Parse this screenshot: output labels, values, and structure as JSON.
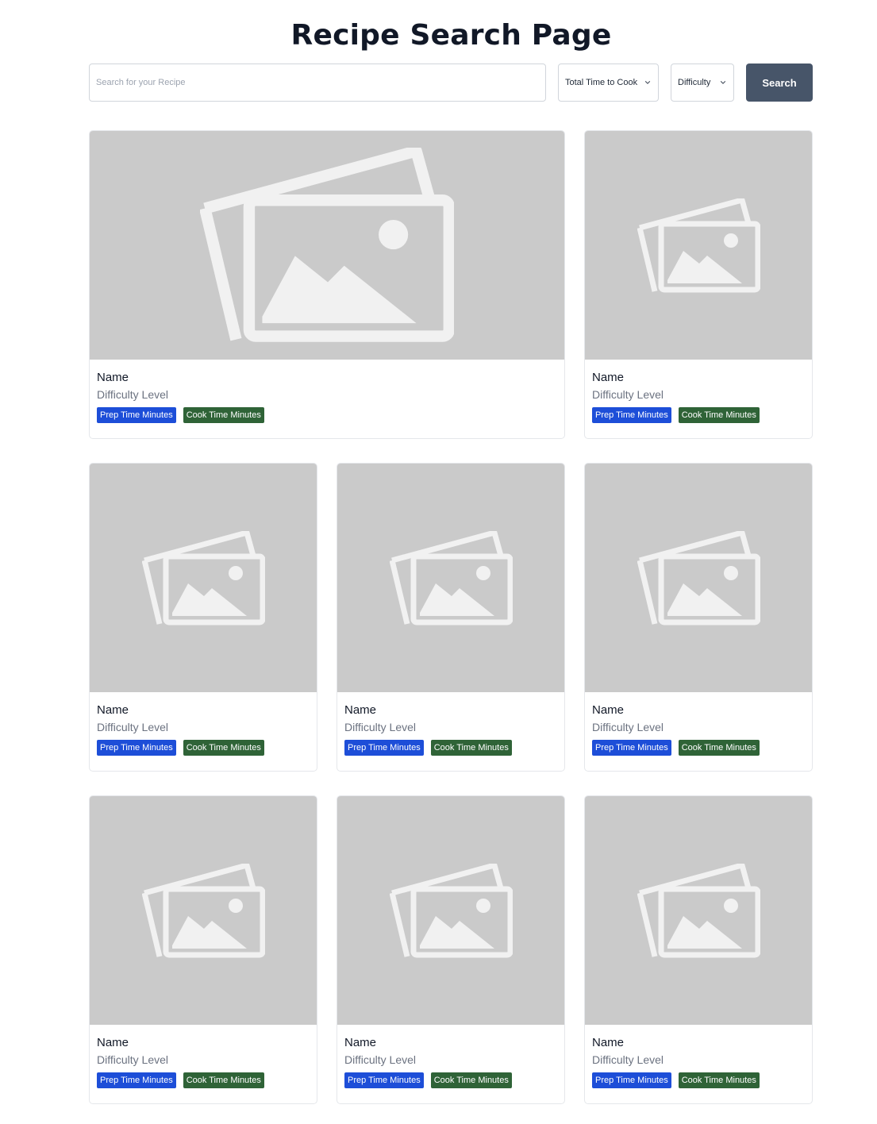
{
  "header": {
    "title": "Recipe Search Page"
  },
  "search": {
    "placeholder": "Search for your Recipe",
    "value": "",
    "time_select": "Total Time to Cook",
    "difficulty_select": "Difficulty",
    "button_label": "Search",
    "button_color": "#475569"
  },
  "cards": [
    {
      "name": "Name",
      "difficulty": "Difficulty Level",
      "prep": "Prep Time Minutes",
      "cook": "Cook Time Minutes",
      "image_icon": "image-placeholder-icon"
    },
    {
      "name": "Name",
      "difficulty": "Difficulty Level",
      "prep": "Prep Time Minutes",
      "cook": "Cook Time Minutes",
      "image_icon": "image-placeholder-icon"
    },
    {
      "name": "Name",
      "difficulty": "Difficulty Level",
      "prep": "Prep Time Minutes",
      "cook": "Cook Time Minutes",
      "image_icon": "image-placeholder-icon"
    },
    {
      "name": "Name",
      "difficulty": "Difficulty Level",
      "prep": "Prep Time Minutes",
      "cook": "Cook Time Minutes",
      "image_icon": "image-placeholder-icon"
    },
    {
      "name": "Name",
      "difficulty": "Difficulty Level",
      "prep": "Prep Time Minutes",
      "cook": "Cook Time Minutes",
      "image_icon": "image-placeholder-icon"
    },
    {
      "name": "Name",
      "difficulty": "Difficulty Level",
      "prep": "Prep Time Minutes",
      "cook": "Cook Time Minutes",
      "image_icon": "image-placeholder-icon"
    },
    {
      "name": "Name",
      "difficulty": "Difficulty Level",
      "prep": "Prep Time Minutes",
      "cook": "Cook Time Minutes",
      "image_icon": "image-placeholder-icon"
    },
    {
      "name": "Name",
      "difficulty": "Difficulty Level",
      "prep": "Prep Time Minutes",
      "cook": "Cook Time Minutes",
      "image_icon": "image-placeholder-icon"
    }
  ],
  "colors": {
    "prep_badge": "#1d4ed8",
    "cook_badge": "#2f6337",
    "image_placeholder": "#cacaca"
  }
}
